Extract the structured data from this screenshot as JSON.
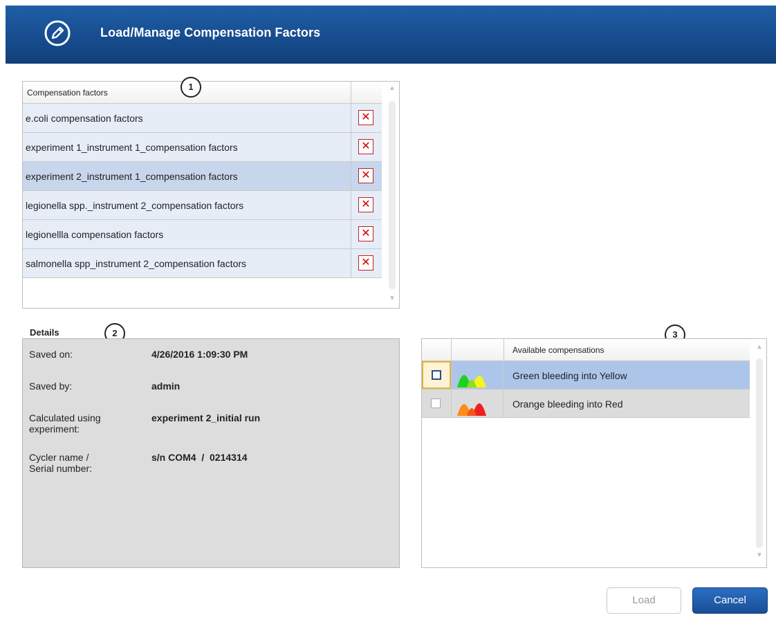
{
  "dialog": {
    "title": "Load/Manage Compensation Factors",
    "icon": "pencil-icon"
  },
  "callouts": [
    "1",
    "2",
    "3"
  ],
  "factors_panel": {
    "column_header": "Compensation factors",
    "rows": [
      {
        "name": "e.coli compensation factors",
        "selected": false
      },
      {
        "name": "experiment 1_instrument 1_compensation factors",
        "selected": false
      },
      {
        "name": "experiment 2_instrument 1_compensation factors",
        "selected": true
      },
      {
        "name": "legionella spp._instrument 2_compensation factors",
        "selected": false
      },
      {
        "name": "legionellla compensation factors",
        "selected": false
      },
      {
        "name": "salmonella spp_instrument 2_compensation factors",
        "selected": false
      }
    ],
    "delete_glyph": "✕"
  },
  "details": {
    "title": "Details",
    "fields": [
      {
        "label": "Saved on:",
        "value": "4/26/2016 1:09:30 PM"
      },
      {
        "label": "Saved by:",
        "value": "admin"
      },
      {
        "label": "Calculated using experiment:",
        "value": "experiment 2_initial run"
      },
      {
        "label": "Cycler name / Serial number:",
        "value": "s/n COM4  /  0214314"
      }
    ]
  },
  "compensations_panel": {
    "column_header": "Available compensations",
    "rows": [
      {
        "label": "Green bleeding into Yellow",
        "checked": false,
        "focused": true,
        "colors": [
          "#1fd01f",
          "#f5f51a"
        ]
      },
      {
        "label": "Orange bleeding into Red",
        "checked": false,
        "focused": false,
        "colors": [
          "#ff8c1a",
          "#ee1f1f"
        ]
      }
    ]
  },
  "buttons": {
    "load": "Load",
    "cancel": "Cancel"
  }
}
